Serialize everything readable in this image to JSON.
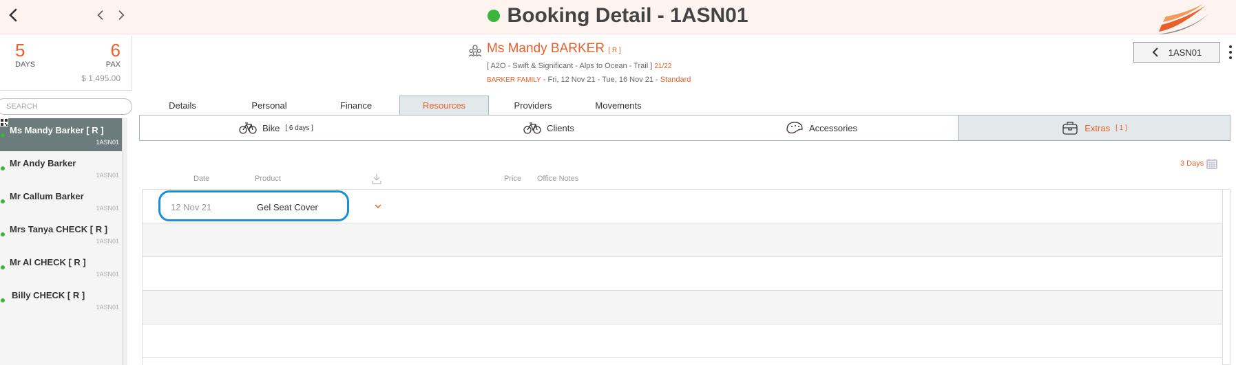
{
  "header": {
    "title": "Booking Detail - 1ASN01",
    "status_color": "#3bb53b",
    "back_icon": "chevron-left-icon",
    "prev_icon": "chevron-left-icon",
    "next_icon": "chevron-right-icon",
    "logo": "swoosh-logo"
  },
  "summary": {
    "days_value": "5",
    "days_label": "DAYS",
    "pax_value": "6",
    "pax_label": "PAX",
    "price": "$ 1,495.00"
  },
  "search": {
    "placeholder": "SEARCH"
  },
  "passengers": [
    {
      "name": "Ms Mandy Barker  [ R ]",
      "ref": "1ASN01"
    },
    {
      "name": "Mr Andy Barker",
      "ref": "1ASN01"
    },
    {
      "name": "Mr Callum Barker",
      "ref": "1ASN01"
    },
    {
      "name": "Mrs Tanya CHECK  [ R ]",
      "ref": "1ASN01"
    },
    {
      "name": "Mr Al CHECK  [ R ]",
      "ref": "1ASN01"
    },
    {
      "name": "Billy CHECK  [ R ]",
      "ref": "1ASN01"
    }
  ],
  "client": {
    "name": "Ms Mandy BARKER",
    "tag": "[ R ]",
    "trip": "[ A2O - Swift & Significant - Alps to Ocean - Trail ]",
    "trip_code": "21/22",
    "family": "BARKER FAMILY",
    "dates": "- Fri, 12 Nov 21 - Tue, 16 Nov 21 -",
    "grade": "Standard",
    "ref_button": "1ASN01"
  },
  "tabs": [
    "Details",
    "Personal",
    "Finance",
    "Resources",
    "Providers",
    "Movements"
  ],
  "subtabs": {
    "bike_label": "Bike",
    "bike_count": "[ 6 days ]",
    "clients_label": "Clients",
    "accessories_label": "Accessories",
    "extras_label": "Extras",
    "extras_count": "[ 1 ]"
  },
  "days_link": "3 Days",
  "columns": {
    "date": "Date",
    "product": "Product",
    "price": "Price",
    "office_notes": "Office Notes"
  },
  "rows": [
    {
      "date": "12 Nov 21",
      "product": "Gel Seat Cover"
    }
  ],
  "colors": {
    "accent": "#e8602c",
    "active_tab_bg": "#e3e9ea",
    "selected_pax_bg": "#6c7b7c",
    "highlight_ring": "#1b8fd6"
  }
}
